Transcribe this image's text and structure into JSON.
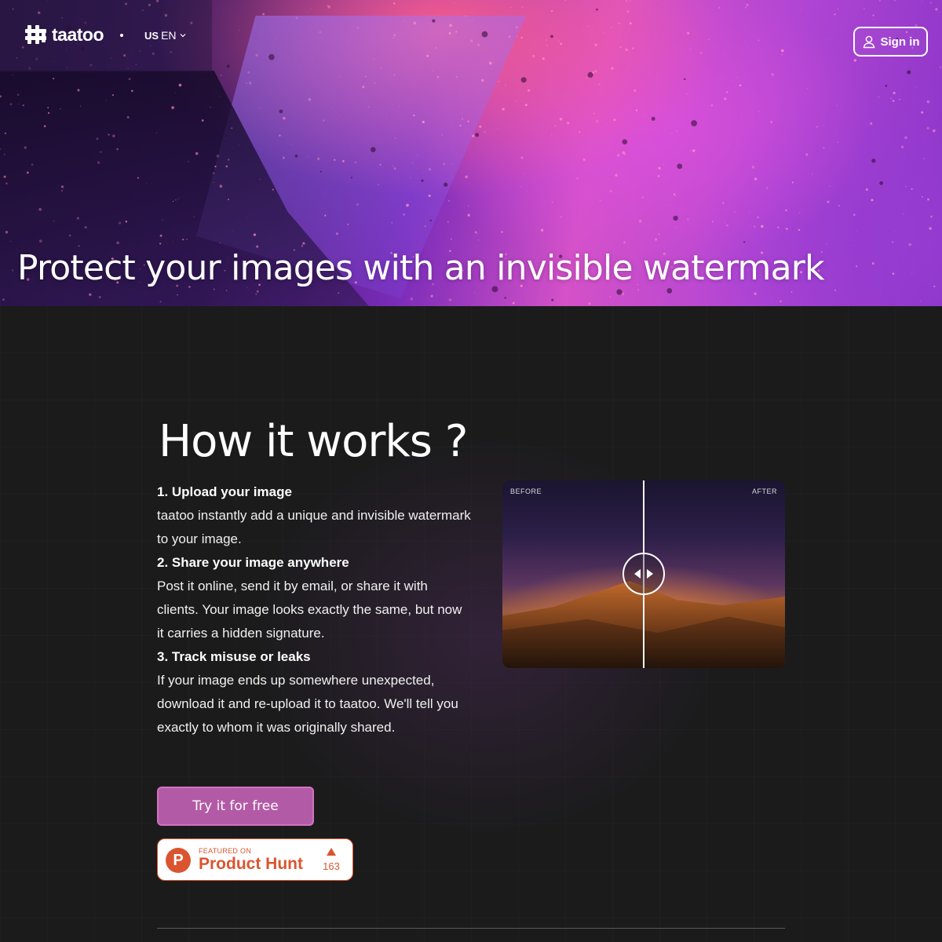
{
  "header": {
    "brand": "taatoo",
    "language": {
      "flag": "US",
      "code": "EN"
    },
    "sign_in_label": "Sign in"
  },
  "hero": {
    "title": "Protect your images with an invisible watermark"
  },
  "how_it_works": {
    "title": "How it works ?",
    "steps": [
      {
        "title": "1. Upload your image",
        "body": "taatoo instantly add a unique and invisible watermark to your image."
      },
      {
        "title": "2. Share your image anywhere",
        "body": "Post it online, send it by email, or share it with clients. Your image looks exactly the same, but now it carries a hidden signature."
      },
      {
        "title": "3. Track misuse or leaks",
        "body": "If your image ends up somewhere unexpected, download it and re-upload it to taatoo. We'll tell you exactly to whom it was originally shared."
      }
    ]
  },
  "comparison": {
    "before_label": "BEFORE",
    "after_label": "AFTER"
  },
  "cta": {
    "label": "Try it for free"
  },
  "product_hunt": {
    "featured_label": "FEATURED ON",
    "name": "Product Hunt",
    "upvotes": "163",
    "logo_letter": "P"
  },
  "colors": {
    "background": "#1b1b1c",
    "cta": "#b35aa6",
    "product_hunt": "#da552f"
  },
  "icons": {
    "logo": "taatoo-hash-logo-icon",
    "language_dropdown": "chevron-down-icon",
    "sign_in": "user-icon",
    "compare_handle": "left-right-arrows-icon",
    "product_hunt_upvote": "triangle-up-icon"
  }
}
